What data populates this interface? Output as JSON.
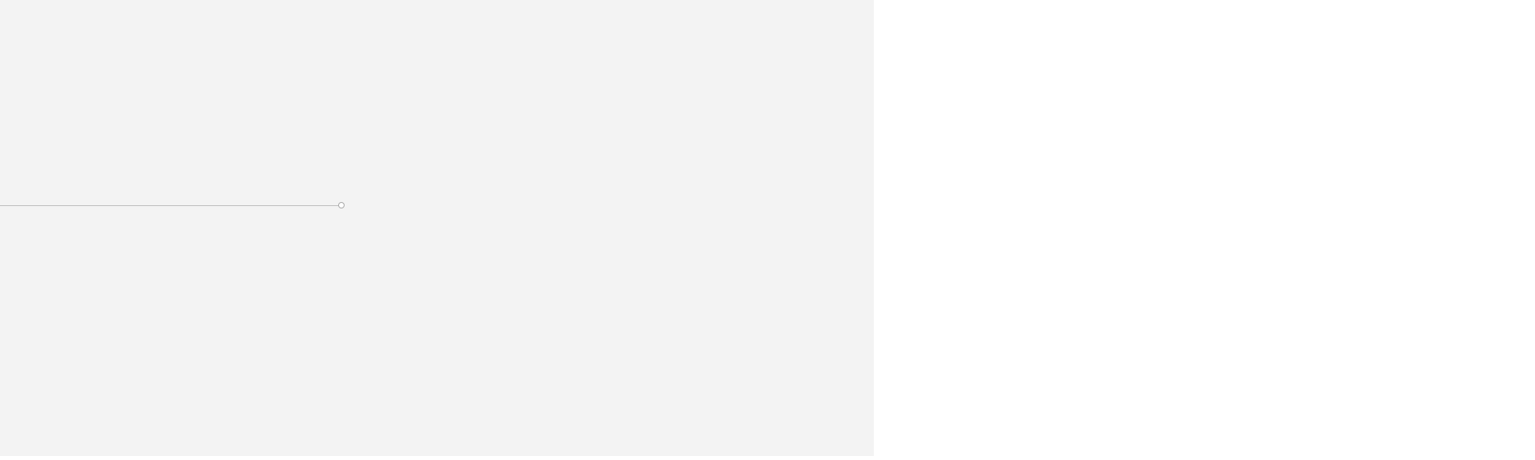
{
  "colors": {
    "left_panel_background": "#f3f3f3",
    "right_panel_background": "#ffffff",
    "slider_track": "#bdbdbd",
    "slider_handle_border": "#a9a9a9"
  },
  "slider": {
    "value_fraction": 0.39
  }
}
